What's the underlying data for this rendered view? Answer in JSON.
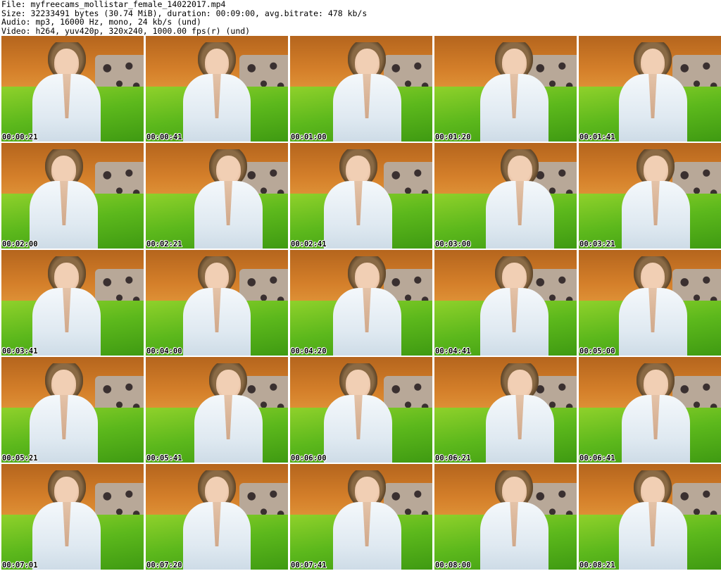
{
  "header": {
    "file": "File: myfreecams_mollistar_female_14022017.mp4",
    "size": "Size: 32233491 bytes (30.74 MiB), duration: 00:09:00, avg.bitrate: 478 kb/s",
    "audio": "Audio: mp3, 16000 Hz, mono, 24 kb/s (und)",
    "video": "Video: h264, yuv420p, 320x240, 1000.00 fps(r) (und)"
  },
  "thumbnails": [
    {
      "timestamp": "00:00:21"
    },
    {
      "timestamp": "00:00:41"
    },
    {
      "timestamp": "00:01:00"
    },
    {
      "timestamp": "00:01:20"
    },
    {
      "timestamp": "00:01:41"
    },
    {
      "timestamp": "00:02:00"
    },
    {
      "timestamp": "00:02:21"
    },
    {
      "timestamp": "00:02:41"
    },
    {
      "timestamp": "00:03:00"
    },
    {
      "timestamp": "00:03:21"
    },
    {
      "timestamp": "00:03:41"
    },
    {
      "timestamp": "00:04:00"
    },
    {
      "timestamp": "00:04:20"
    },
    {
      "timestamp": "00:04:41"
    },
    {
      "timestamp": "00:05:00"
    },
    {
      "timestamp": "00:05:21"
    },
    {
      "timestamp": "00:05:41"
    },
    {
      "timestamp": "00:06:00"
    },
    {
      "timestamp": "00:06:21"
    },
    {
      "timestamp": "00:06:41"
    },
    {
      "timestamp": "00:07:01"
    },
    {
      "timestamp": "00:07:20"
    },
    {
      "timestamp": "00:07:41"
    },
    {
      "timestamp": "00:08:00"
    },
    {
      "timestamp": "00:08:21"
    }
  ]
}
